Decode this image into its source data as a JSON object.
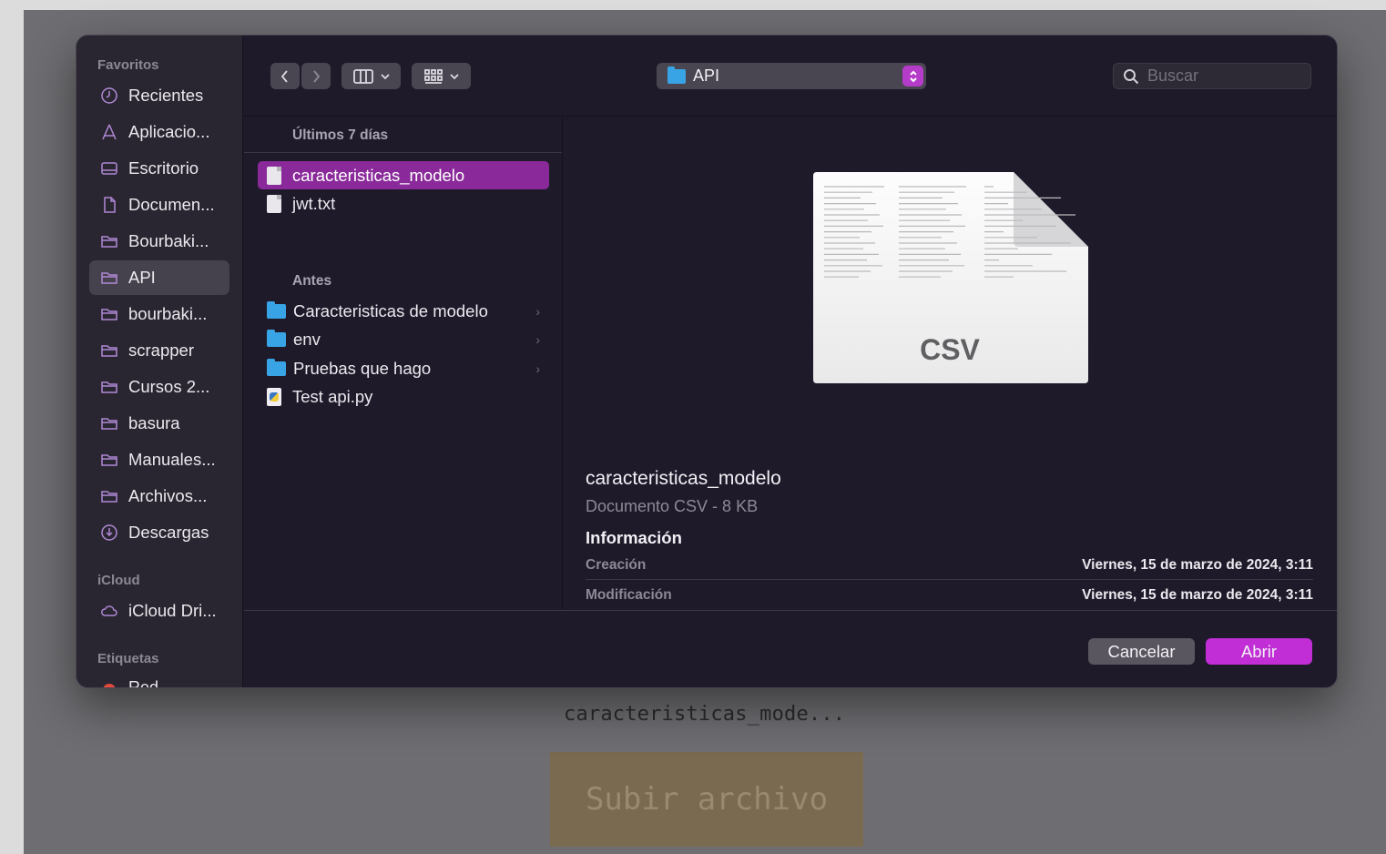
{
  "sidebar": {
    "sections": {
      "favorites": "Favoritos",
      "icloud": "iCloud",
      "tags": "Etiquetas"
    },
    "favorites": [
      {
        "label": "Recientes",
        "icon": "clock-icon"
      },
      {
        "label": "Aplicacio...",
        "icon": "apps-icon"
      },
      {
        "label": "Escritorio",
        "icon": "desktop-icon"
      },
      {
        "label": "Documen...",
        "icon": "document-icon"
      },
      {
        "label": "Bourbaki...",
        "icon": "folder-icon"
      },
      {
        "label": "API",
        "icon": "folder-icon",
        "active": true
      },
      {
        "label": "bourbaki...",
        "icon": "folder-icon"
      },
      {
        "label": "scrapper",
        "icon": "folder-icon"
      },
      {
        "label": "Cursos 2...",
        "icon": "folder-icon"
      },
      {
        "label": "basura",
        "icon": "folder-icon"
      },
      {
        "label": "Manuales...",
        "icon": "folder-icon"
      },
      {
        "label": "Archivos...",
        "icon": "folder-icon"
      },
      {
        "label": "Descargas",
        "icon": "download-icon"
      }
    ],
    "icloud": [
      {
        "label": "iCloud Dri...",
        "icon": "cloud-icon"
      }
    ],
    "tags": [
      {
        "label": "Red",
        "color": "#e24a3b"
      }
    ]
  },
  "toolbar": {
    "path_label": "API",
    "search_placeholder": "Buscar"
  },
  "browser": {
    "recent_header": "Últimos 7 días",
    "recent": [
      {
        "name": "caracteristicas_modelo",
        "kind": "document",
        "selected": true
      },
      {
        "name": "jwt.txt",
        "kind": "document"
      }
    ],
    "older_header": "Antes",
    "older": [
      {
        "name": "Caracteristicas de modelo",
        "kind": "folder",
        "chevron": "›"
      },
      {
        "name": "env",
        "kind": "folder",
        "chevron": "›"
      },
      {
        "name": "Pruebas que hago",
        "kind": "folder",
        "chevron": "›"
      },
      {
        "name": "Test api.py",
        "kind": "python"
      }
    ]
  },
  "preview": {
    "thumb_label": "CSV",
    "name": "caracteristicas_modelo",
    "kind": "Documento CSV - 8 KB",
    "info_title": "Información",
    "created_label": "Creación",
    "created_value": "Viernes, 15 de marzo de 2024, 3:11",
    "modified_label": "Modificación",
    "modified_value": "Viernes, 15 de marzo de 2024, 3:11"
  },
  "footer": {
    "cancel": "Cancelar",
    "open": "Abrir"
  },
  "page": {
    "selected_file": "caracteristicas_mode...",
    "upload_button": "Subir archivo"
  },
  "colors": {
    "accent": "#c22ed6",
    "selection": "#8a2a9a",
    "folder": "#38a4e6"
  }
}
